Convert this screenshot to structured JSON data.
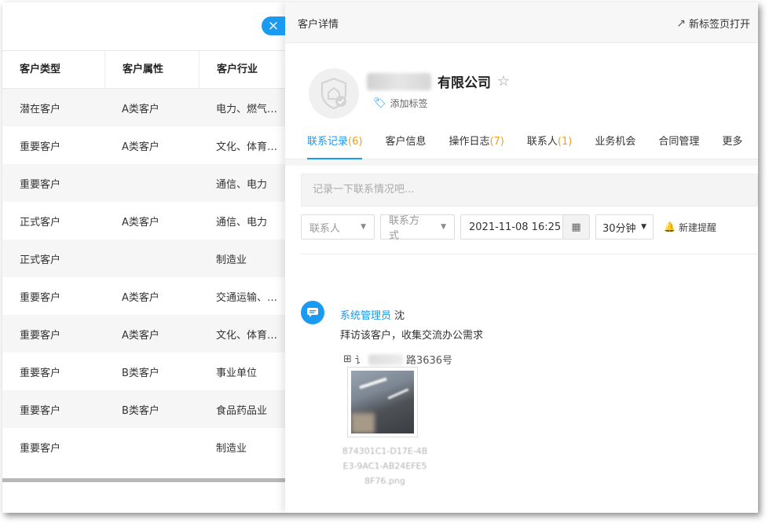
{
  "list": {
    "headers": [
      "客户类型",
      "客户属性",
      "客户行业"
    ],
    "rows": [
      [
        "潜在客户",
        "A类客户",
        "电力、燃气及..."
      ],
      [
        "重要客户",
        "A类客户",
        "文化、体育和..."
      ],
      [
        "重要客户",
        "",
        "通信、电力"
      ],
      [
        "正式客户",
        "A类客户",
        "通信、电力"
      ],
      [
        "正式客户",
        "",
        "制造业"
      ],
      [
        "重要客户",
        "A类客户",
        "交通运输、仓..."
      ],
      [
        "重要客户",
        "A类客户",
        "文化、体育和..."
      ],
      [
        "重要客户",
        "B类客户",
        "事业单位"
      ],
      [
        "重要客户",
        "B类客户",
        "食品药品业"
      ],
      [
        "重要客户",
        "",
        "制造业"
      ]
    ]
  },
  "drawer": {
    "close_glyph": "×",
    "title": "客户详情",
    "new_tab_icon": "↗",
    "new_tab_label": "新标签页打开",
    "company_name": "有限公司",
    "star_glyph": "☆",
    "add_tag_icon": "🏷",
    "add_tag_label": "添加标签",
    "tabs": [
      {
        "label": "联系记录",
        "count": "(6)"
      },
      {
        "label": "客户信息",
        "count": ""
      },
      {
        "label": "操作日志",
        "count": "(7)"
      },
      {
        "label": "联系人",
        "count": "(1)"
      },
      {
        "label": "业务机会",
        "count": ""
      },
      {
        "label": "合同管理",
        "count": ""
      },
      {
        "label": "更多",
        "count": ""
      }
    ],
    "note_placeholder": "记录一下联系情况吧...",
    "contact_select": "联系人",
    "method_select": "联系方式",
    "datetime": "2021-11-08 16:25",
    "calendar_icon": "▦",
    "duration": "30分钟",
    "caret": "▼",
    "bell_icon": "🔔",
    "reminder_label": "新建提醒"
  },
  "entry": {
    "user": "系统管理员",
    "surname": "沈",
    "text": "拜访该客户，收集交流办公需求",
    "address_icon": "⊞",
    "address_prefix": "讠",
    "address_suffix": "路3636号",
    "filename": "874301C1-D17E-4BE3-9AC1-AB24EFE58F76.png"
  },
  "colors": {
    "accent": "#1a9af0",
    "count": "#f0a020"
  }
}
